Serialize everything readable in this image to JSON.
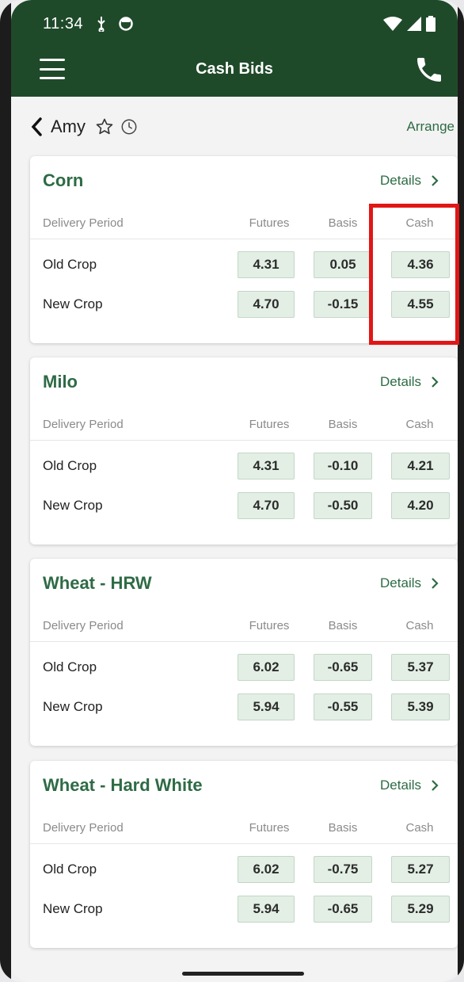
{
  "status_bar": {
    "time": "11:34"
  },
  "app_bar": {
    "title": "Cash Bids"
  },
  "sub_bar": {
    "name": "Amy",
    "arrange_label": "Arrange"
  },
  "table_headers": {
    "period": "Delivery Period",
    "futures": "Futures",
    "basis": "Basis",
    "cash": "Cash"
  },
  "details_label": "Details",
  "commodities": [
    {
      "name": "Corn",
      "rows": [
        {
          "period": "Old Crop",
          "futures": "4.31",
          "basis": "0.05",
          "cash": "4.36"
        },
        {
          "period": "New Crop",
          "futures": "4.70",
          "basis": "-0.15",
          "cash": "4.55"
        }
      ]
    },
    {
      "name": "Milo",
      "rows": [
        {
          "period": "Old Crop",
          "futures": "4.31",
          "basis": "-0.10",
          "cash": "4.21"
        },
        {
          "period": "New Crop",
          "futures": "4.70",
          "basis": "-0.50",
          "cash": "4.20"
        }
      ]
    },
    {
      "name": "Wheat - HRW",
      "rows": [
        {
          "period": "Old Crop",
          "futures": "6.02",
          "basis": "-0.65",
          "cash": "5.37"
        },
        {
          "period": "New Crop",
          "futures": "5.94",
          "basis": "-0.55",
          "cash": "5.39"
        }
      ]
    },
    {
      "name": "Wheat - Hard White",
      "rows": [
        {
          "period": "Old Crop",
          "futures": "6.02",
          "basis": "-0.75",
          "cash": "5.27"
        },
        {
          "period": "New Crop",
          "futures": "5.94",
          "basis": "-0.65",
          "cash": "5.29"
        }
      ]
    }
  ],
  "colors": {
    "primary": "#1f4a2a",
    "accent": "#2e6b45",
    "highlight": "#e11616"
  }
}
